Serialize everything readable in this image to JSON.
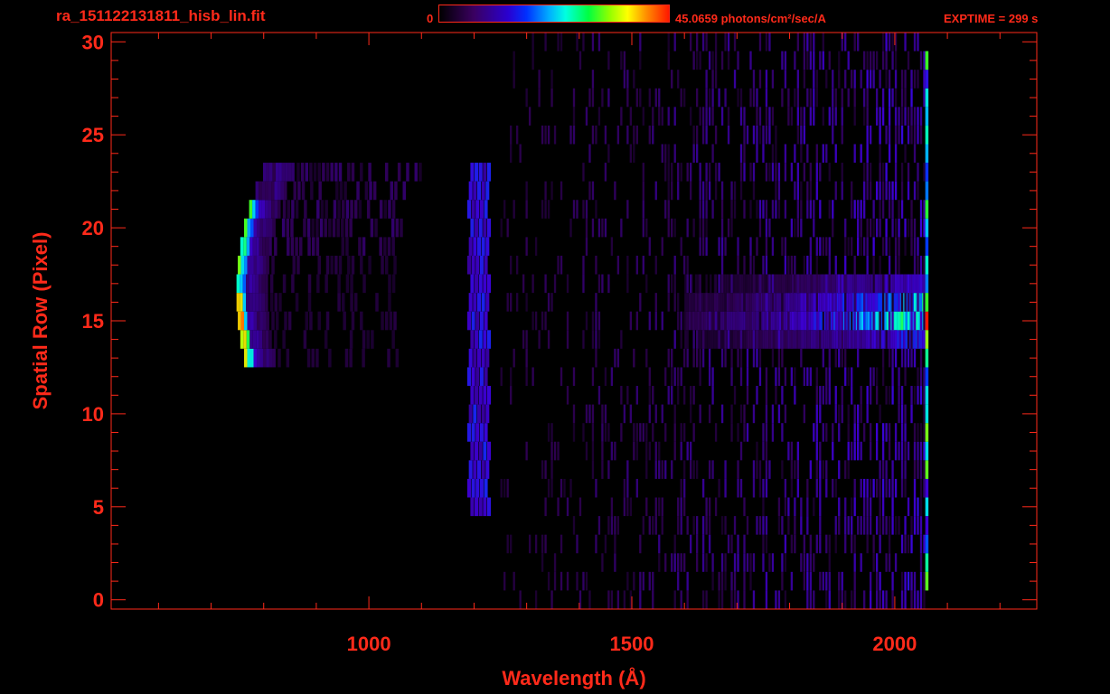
{
  "header": {
    "filename": "ra_151122131811_hisb_lin.fit",
    "colorbar_min": "0",
    "colorbar_max": "45.0659 photons/cm²/sec/A",
    "exptime": "EXPTIME = 299 s"
  },
  "colors": {
    "axes": "#ff2a1a",
    "background": "#000000"
  },
  "chart_data": {
    "type": "heatmap",
    "title": "",
    "xlabel": "Wavelength (Å)",
    "ylabel": "Spatial Row (Pixel)",
    "xlim": [
      510,
      2270
    ],
    "ylim": [
      -0.5,
      30.5
    ],
    "xticks": [
      1000,
      1500,
      2000
    ],
    "xtick_labels": [
      "1000",
      "1500",
      "2000"
    ],
    "yticks": [
      0,
      5,
      10,
      15,
      20,
      25,
      30
    ],
    "ytick_labels": [
      "0",
      "5",
      "10",
      "15",
      "20",
      "25",
      "30"
    ],
    "colorbar": {
      "min": 0,
      "max": 45.0659,
      "unit": "photons/cm²/sec/A",
      "colormap": "rainbow"
    },
    "features": [
      {
        "name": "emission band 1",
        "x_range": [
          740,
          790
        ],
        "y_range": [
          13,
          21
        ],
        "peak_x": 760,
        "peak_y": 15
      },
      {
        "name": "emission band 2",
        "x_range": [
          1190,
          1230
        ],
        "y_range": [
          5,
          23
        ]
      },
      {
        "name": "continuum",
        "x_range": [
          1600,
          2060
        ],
        "y_range": [
          14,
          17
        ],
        "peak_x": 2000
      }
    ],
    "grid": false
  }
}
